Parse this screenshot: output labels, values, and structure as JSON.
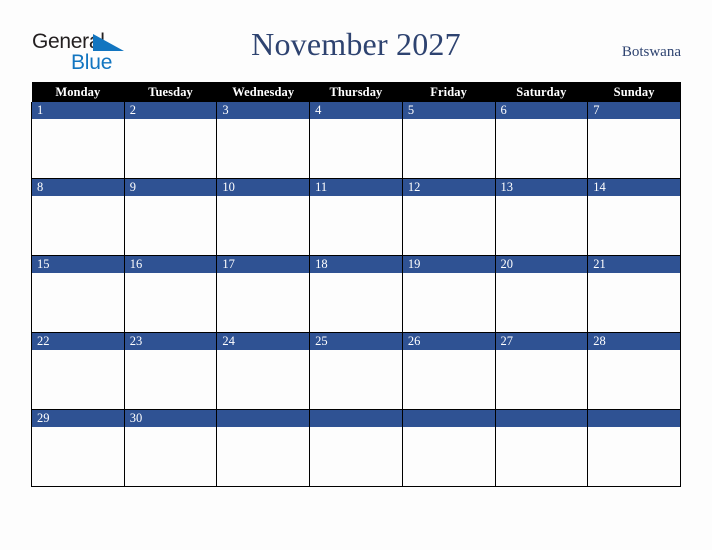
{
  "logo": {
    "word_top": "General",
    "word_bottom": "Blue",
    "triangle_color": "#1275c0",
    "text_color": "#231f20"
  },
  "header": {
    "title": "November 2027",
    "country": "Botswana",
    "title_color": "#2e4370"
  },
  "calendar": {
    "day_headers": [
      "Monday",
      "Tuesday",
      "Wednesday",
      "Thursday",
      "Friday",
      "Saturday",
      "Sunday"
    ],
    "header_bg": "#000000",
    "header_text": "#ffffff",
    "daynum_bg": "#2f5293",
    "daynum_text": "#ffffff",
    "cell_bg": "#fdfdfd",
    "weeks": [
      {
        "days": [
          {
            "num": "1",
            "note": ""
          },
          {
            "num": "2",
            "note": ""
          },
          {
            "num": "3",
            "note": ""
          },
          {
            "num": "4",
            "note": ""
          },
          {
            "num": "5",
            "note": ""
          },
          {
            "num": "6",
            "note": ""
          },
          {
            "num": "7",
            "note": ""
          }
        ]
      },
      {
        "days": [
          {
            "num": "8",
            "note": ""
          },
          {
            "num": "9",
            "note": ""
          },
          {
            "num": "10",
            "note": ""
          },
          {
            "num": "11",
            "note": ""
          },
          {
            "num": "12",
            "note": ""
          },
          {
            "num": "13",
            "note": ""
          },
          {
            "num": "14",
            "note": ""
          }
        ]
      },
      {
        "days": [
          {
            "num": "15",
            "note": ""
          },
          {
            "num": "16",
            "note": ""
          },
          {
            "num": "17",
            "note": ""
          },
          {
            "num": "18",
            "note": ""
          },
          {
            "num": "19",
            "note": ""
          },
          {
            "num": "20",
            "note": ""
          },
          {
            "num": "21",
            "note": ""
          }
        ]
      },
      {
        "days": [
          {
            "num": "22",
            "note": ""
          },
          {
            "num": "23",
            "note": ""
          },
          {
            "num": "24",
            "note": ""
          },
          {
            "num": "25",
            "note": ""
          },
          {
            "num": "26",
            "note": ""
          },
          {
            "num": "27",
            "note": ""
          },
          {
            "num": "28",
            "note": ""
          }
        ]
      },
      {
        "days": [
          {
            "num": "29",
            "note": ""
          },
          {
            "num": "30",
            "note": ""
          },
          {
            "num": "",
            "note": ""
          },
          {
            "num": "",
            "note": ""
          },
          {
            "num": "",
            "note": ""
          },
          {
            "num": "",
            "note": ""
          },
          {
            "num": "",
            "note": ""
          }
        ]
      }
    ]
  }
}
